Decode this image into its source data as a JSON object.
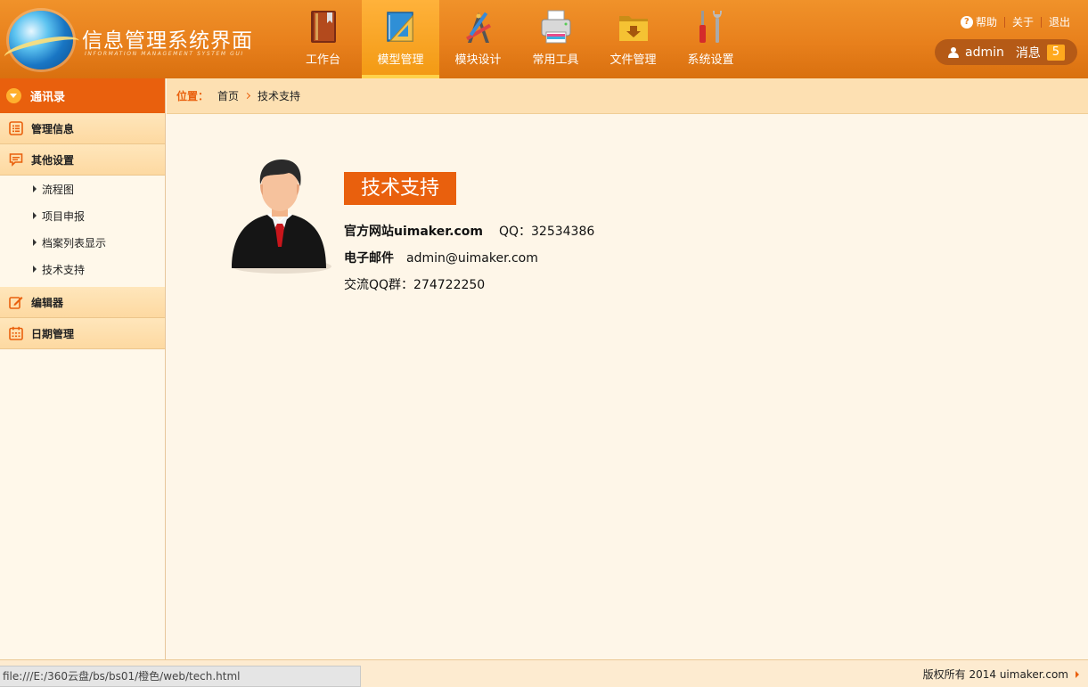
{
  "header": {
    "title": "信息管理系统界面",
    "subtitle": "INFORMATION MANAGEMENT SYSTEM GUI",
    "nav": [
      {
        "label": "工作台",
        "icon": "book-icon"
      },
      {
        "label": "模型管理",
        "icon": "ruler-icon",
        "active": true
      },
      {
        "label": "模块设计",
        "icon": "design-tools-icon"
      },
      {
        "label": "常用工具",
        "icon": "printer-icon"
      },
      {
        "label": "文件管理",
        "icon": "folder-icon"
      },
      {
        "label": "系统设置",
        "icon": "wrench-icon"
      }
    ],
    "links": {
      "help": "帮助",
      "about": "关于",
      "logout": "退出"
    },
    "user": {
      "name": "admin",
      "message_label": "消息",
      "message_count": "5"
    }
  },
  "sidebar": {
    "header": "通讯录",
    "groups": [
      {
        "label": "管理信息"
      },
      {
        "label": "其他设置",
        "items": [
          "流程图",
          "项目申报",
          "档案列表显示",
          "技术支持"
        ]
      },
      {
        "label": "编辑器"
      },
      {
        "label": "日期管理"
      }
    ]
  },
  "breadcrumb": {
    "position_label": "位置：",
    "home": "首页",
    "current": "技术支持"
  },
  "main": {
    "badge": "技术支持",
    "website_label": "官方网站uimaker.com",
    "qq": "QQ：32534386",
    "email_label": "电子邮件",
    "email": "admin@uimaker.com",
    "group": "交流QQ群：274722250"
  },
  "footer": {
    "status_url": "file:///E:/360云盘/bs/bs01/橙色/web/tech.html",
    "copyright": "版权所有 2014 uimaker.com"
  },
  "colors": {
    "accent": "#e9600d",
    "header": "#e8801c",
    "active_tab": "#f39a14"
  }
}
